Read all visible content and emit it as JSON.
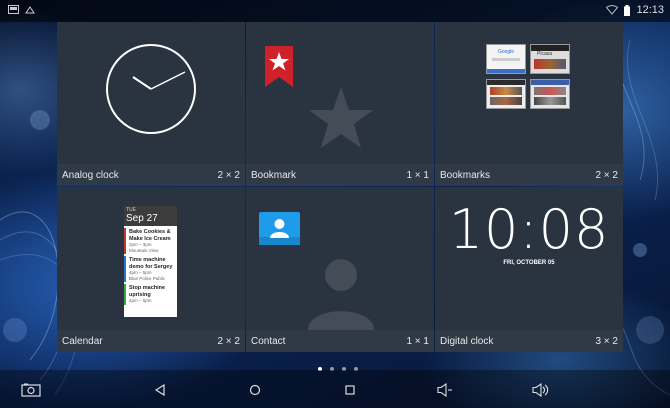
{
  "status_bar": {
    "time": "12:13",
    "icons": [
      "screenshot-icon",
      "settings-icon",
      "wifi-icon",
      "battery-icon"
    ]
  },
  "widgets": [
    {
      "name": "Analog clock",
      "size": "2 × 2",
      "preview": "analog-clock"
    },
    {
      "name": "Bookmark",
      "size": "1 × 1",
      "preview": "bookmark-icon"
    },
    {
      "name": "Bookmarks",
      "size": "2 × 2",
      "preview": "bookmarks-thumbnails"
    },
    {
      "name": "Calendar",
      "size": "2 × 2",
      "preview": "calendar-agenda"
    },
    {
      "name": "Contact",
      "size": "1 × 1",
      "preview": "contact-icon"
    },
    {
      "name": "Digital clock",
      "size": "3 × 2",
      "preview": "digital-clock"
    }
  ],
  "calendar_preview": {
    "day_of_week": "TUE",
    "date": "Sep 27",
    "events": [
      {
        "title_line1": "Bake Cookies &",
        "title_line2": "Make Ice Cream",
        "time": "2pm – 3pm",
        "location": "Mountain View",
        "color": "#c0392b"
      },
      {
        "title_line1": "Time machine",
        "title_line2": "demo for Sergey",
        "time": "4pm – 5pm",
        "location": "Blue Police Public",
        "color": "#2e6fd0"
      },
      {
        "title_line1": "Stop machine",
        "title_line2": "uprising",
        "time": "4pm – 5pm",
        "location": "",
        "color": "#3aa84a"
      }
    ]
  },
  "digital_clock_preview": {
    "time": "10:08",
    "date": "FRI, OCTOBER 05"
  },
  "bookmark_thumbnails": [
    "Google",
    "Picasa",
    "",
    ""
  ],
  "page_indicator": {
    "count": 4,
    "active": 0
  },
  "nav_bar": {
    "buttons": [
      "screenshot-icon",
      "back-icon",
      "home-icon",
      "recents-icon",
      "volume-down-icon",
      "volume-up-icon"
    ]
  },
  "colors": {
    "tile_bg": "#2a3340",
    "caption_bg": "#303a47",
    "bookmark_red": "#d0202a",
    "contact_blue": "#1e9be9"
  }
}
